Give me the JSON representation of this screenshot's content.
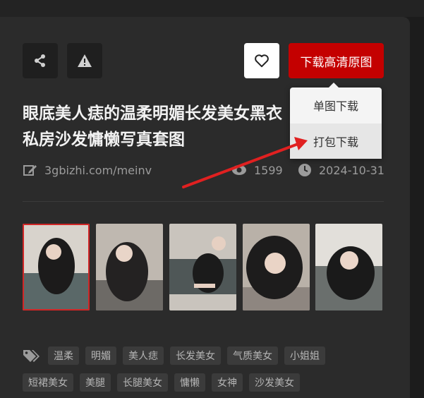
{
  "actions": {
    "download_hd_label": "下载高清原图",
    "dropdown": [
      "单图下载",
      "打包下载"
    ]
  },
  "article": {
    "title_line1": "眼底美人痣的温柔明媚长发美女黑衣",
    "title_line2": "私房沙发慵懒写真套图",
    "source": "3gbizhi.com/meinv",
    "views": "1599",
    "date": "2024-10-31"
  },
  "thumbnails": [
    {
      "colors": [
        "#d8d3cc",
        "#1c1b1b",
        "#5a6868"
      ]
    },
    {
      "colors": [
        "#bfb8b0",
        "#242222",
        "#6d6a66"
      ]
    },
    {
      "colors": [
        "#c9c4bd",
        "#1b1b1b",
        "#4f5757"
      ]
    },
    {
      "colors": [
        "#b9b1a8",
        "#1d1c1c",
        "#8e8680"
      ]
    },
    {
      "colors": [
        "#e2dfda",
        "#1a1a1a",
        "#6a6f6d"
      ]
    }
  ],
  "tags_row1": [
    "温柔",
    "明媚",
    "美人痣",
    "长发美女",
    "气质美女",
    "小姐姐"
  ],
  "tags_row2": [
    "短裙美女",
    "美腿",
    "长腿美女",
    "慵懒",
    "女神",
    "沙发美女"
  ],
  "colors": {
    "accent": "#c40000",
    "card_bg": "#2b2b2b",
    "arrow": "#e02020"
  }
}
